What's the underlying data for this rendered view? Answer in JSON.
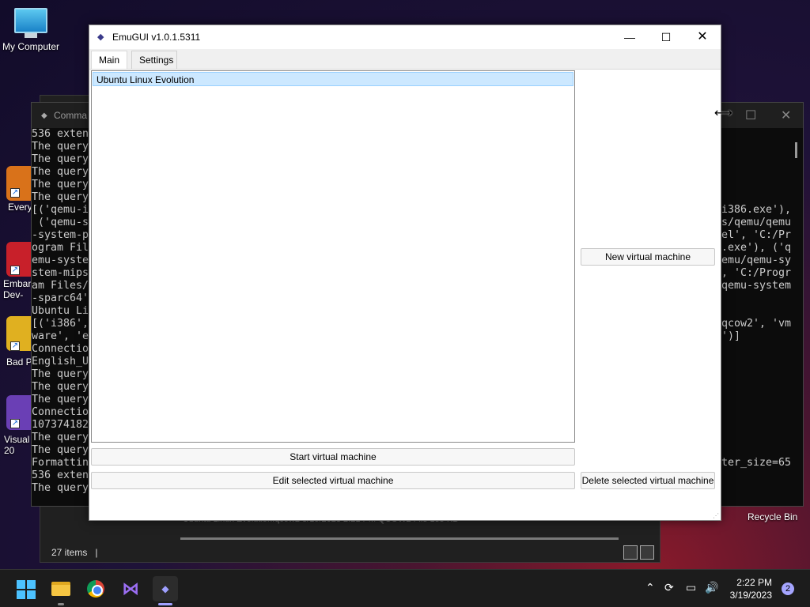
{
  "desktop": {
    "my_computer_label": "My Computer",
    "icon_labels": [
      "Every",
      "Embar\nDev-",
      "Bad P",
      "Visual\n20"
    ],
    "recycle_bin_label": "Recycle Bin"
  },
  "explorer": {
    "status_items": "27 items",
    "status_sep": "|",
    "file_row": "Ubuntu Linux Evolution.qcow2        3/19/2023 2:21 PM        QCOW2 File        155 KB"
  },
  "cmd": {
    "title": "Comma",
    "left_lines": [
      "536 exten",
      "The query",
      "The query",
      "The query",
      "The query",
      "The query",
      "[('qemu-i",
      " ('qemu-s",
      "-system-p",
      "ogram Fil",
      "emu-syste",
      "stem-mips",
      "am Files/",
      "-sparc64'",
      "Ubuntu Li",
      "[('i386',",
      "ware', 'e",
      "Connectio",
      "English_U",
      "The query",
      "The query",
      "The query",
      "Connectio",
      "107374182",
      "The query",
      "The query",
      "Formattin",
      "536 exten",
      "The query"
    ],
    "right_lines": [
      "",
      "",
      "",
      "",
      "",
      "",
      "i386.exe'),",
      "s/qemu/qemu",
      "el', 'C:/Pr",
      ".exe'), ('q",
      "emu/qemu-sy",
      ", 'C:/Progr",
      "qemu-system",
      "",
      "",
      "qcow2', 'vm",
      "')]",
      "",
      "",
      "",
      "",
      "",
      "",
      "",
      "",
      "",
      "ter_size=65",
      "",
      ""
    ]
  },
  "emugui": {
    "title": "EmuGUI v1.0.1.5311",
    "tabs": [
      "Main",
      "Settings"
    ],
    "vm_list": [
      "Ubuntu Linux Evolution"
    ],
    "buttons": {
      "new_vm": "New virtual machine",
      "start_vm": "Start virtual machine",
      "edit_vm": "Edit selected virtual machine",
      "delete_vm": "Delete selected virtual machine"
    }
  },
  "taskbar": {
    "time": "2:22 PM",
    "date": "3/19/2023",
    "notification_count": "2"
  },
  "colors": {
    "selection": "#cce8ff",
    "accent": "#4cc2ff"
  }
}
